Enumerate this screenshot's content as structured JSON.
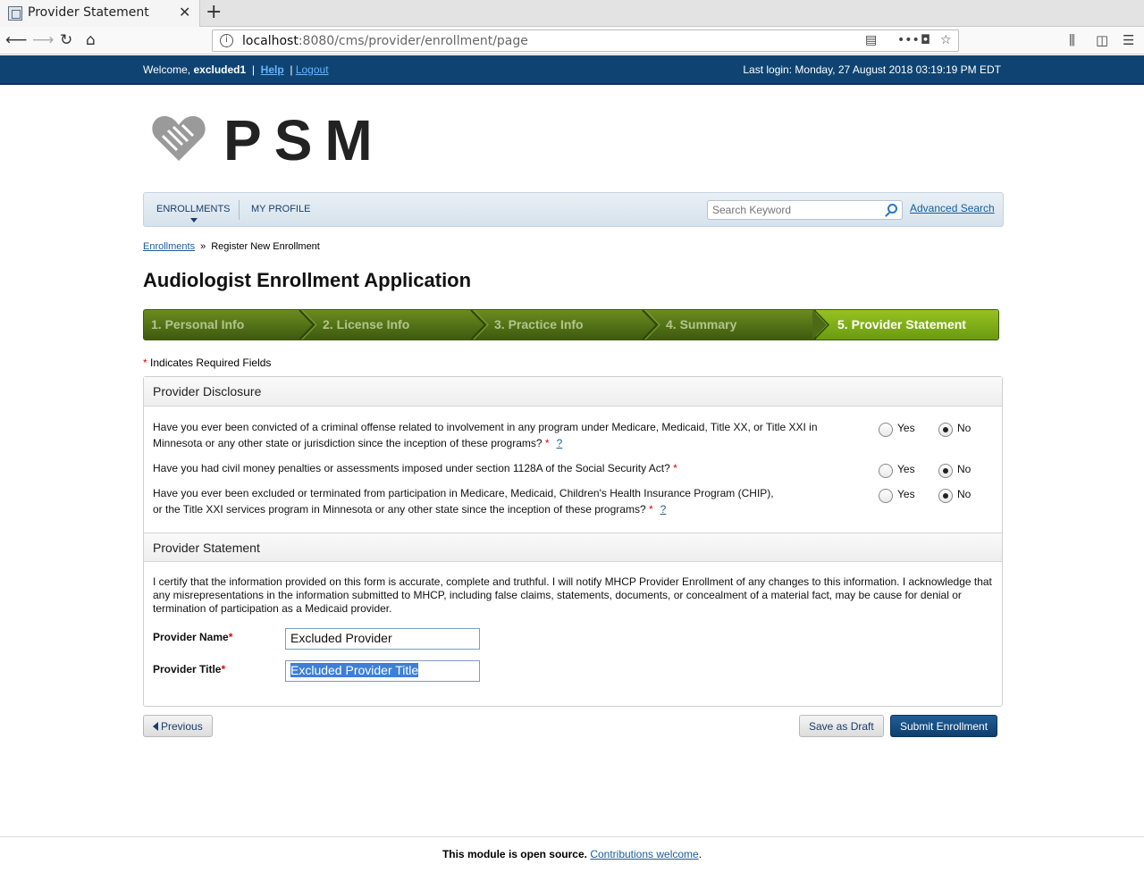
{
  "browser": {
    "tab_title": "Provider Statement",
    "url_host": "localhost",
    "url_rest": ":8080/cms/provider/enrollment/page"
  },
  "topbar": {
    "welcome_prefix": "Welcome,",
    "username": "excluded1",
    "help": "Help",
    "logout": "Logout",
    "last_login": "Last login: Monday, 27 August 2018 03:19:19 PM EDT"
  },
  "logo": {
    "text": "PSM"
  },
  "nav": {
    "enrollments": "ENROLLMENTS",
    "my_profile": "MY PROFILE",
    "search_placeholder": "Search Keyword",
    "advanced_search": "Advanced Search"
  },
  "breadcrumb": {
    "link": "Enrollments",
    "current": "Register New Enrollment"
  },
  "page_title": "Audiologist Enrollment Application",
  "steps": [
    {
      "label": "1. Personal Info"
    },
    {
      "label": "2. License Info"
    },
    {
      "label": "3. Practice Info"
    },
    {
      "label": "4. Summary"
    },
    {
      "label": "5. Provider Statement"
    }
  ],
  "required_note": "Indicates Required Fields",
  "disclosure": {
    "header": "Provider Disclosure",
    "q1_line1": "Have you ever been convicted of a criminal offense related to involvement in any program under Medicare, Medicaid, Title XX, or Title XXI in",
    "q1_line2": "Minnesota or any other state or jurisdiction since the inception of these programs?",
    "q2": "Have you had civil money penalties or assessments imposed under section 1128A of the Social Security Act?",
    "q3_line1": "Have you ever been excluded or terminated from participation in Medicare, Medicaid, Children's Health Insurance Program (CHIP),",
    "q3_line2": "or the Title XXI services program in Minnesota or any other state since the inception of these programs?",
    "yes": "Yes",
    "no": "No",
    "help_mark": "?",
    "star": "*"
  },
  "statement": {
    "header": "Provider Statement",
    "text": "I certify that the information provided on this form is accurate, complete and truthful. I will notify MHCP Provider Enrollment of any changes to this information. I acknowledge that any misrepresentations in the information submitted to MHCP, including false claims, statements, documents, or concealment of a material fact, may be cause for denial or termination of participation as a Medicaid provider.",
    "name_label": "Provider Name",
    "name_value": "Excluded Provider",
    "title_label": "Provider Title",
    "title_value": "Excluded Provider Title"
  },
  "buttons": {
    "previous": "Previous",
    "save_draft": "Save as Draft",
    "submit": "Submit Enrollment"
  },
  "footer": {
    "text": "This module is open source.",
    "link": "Contributions welcome",
    "period": "."
  }
}
